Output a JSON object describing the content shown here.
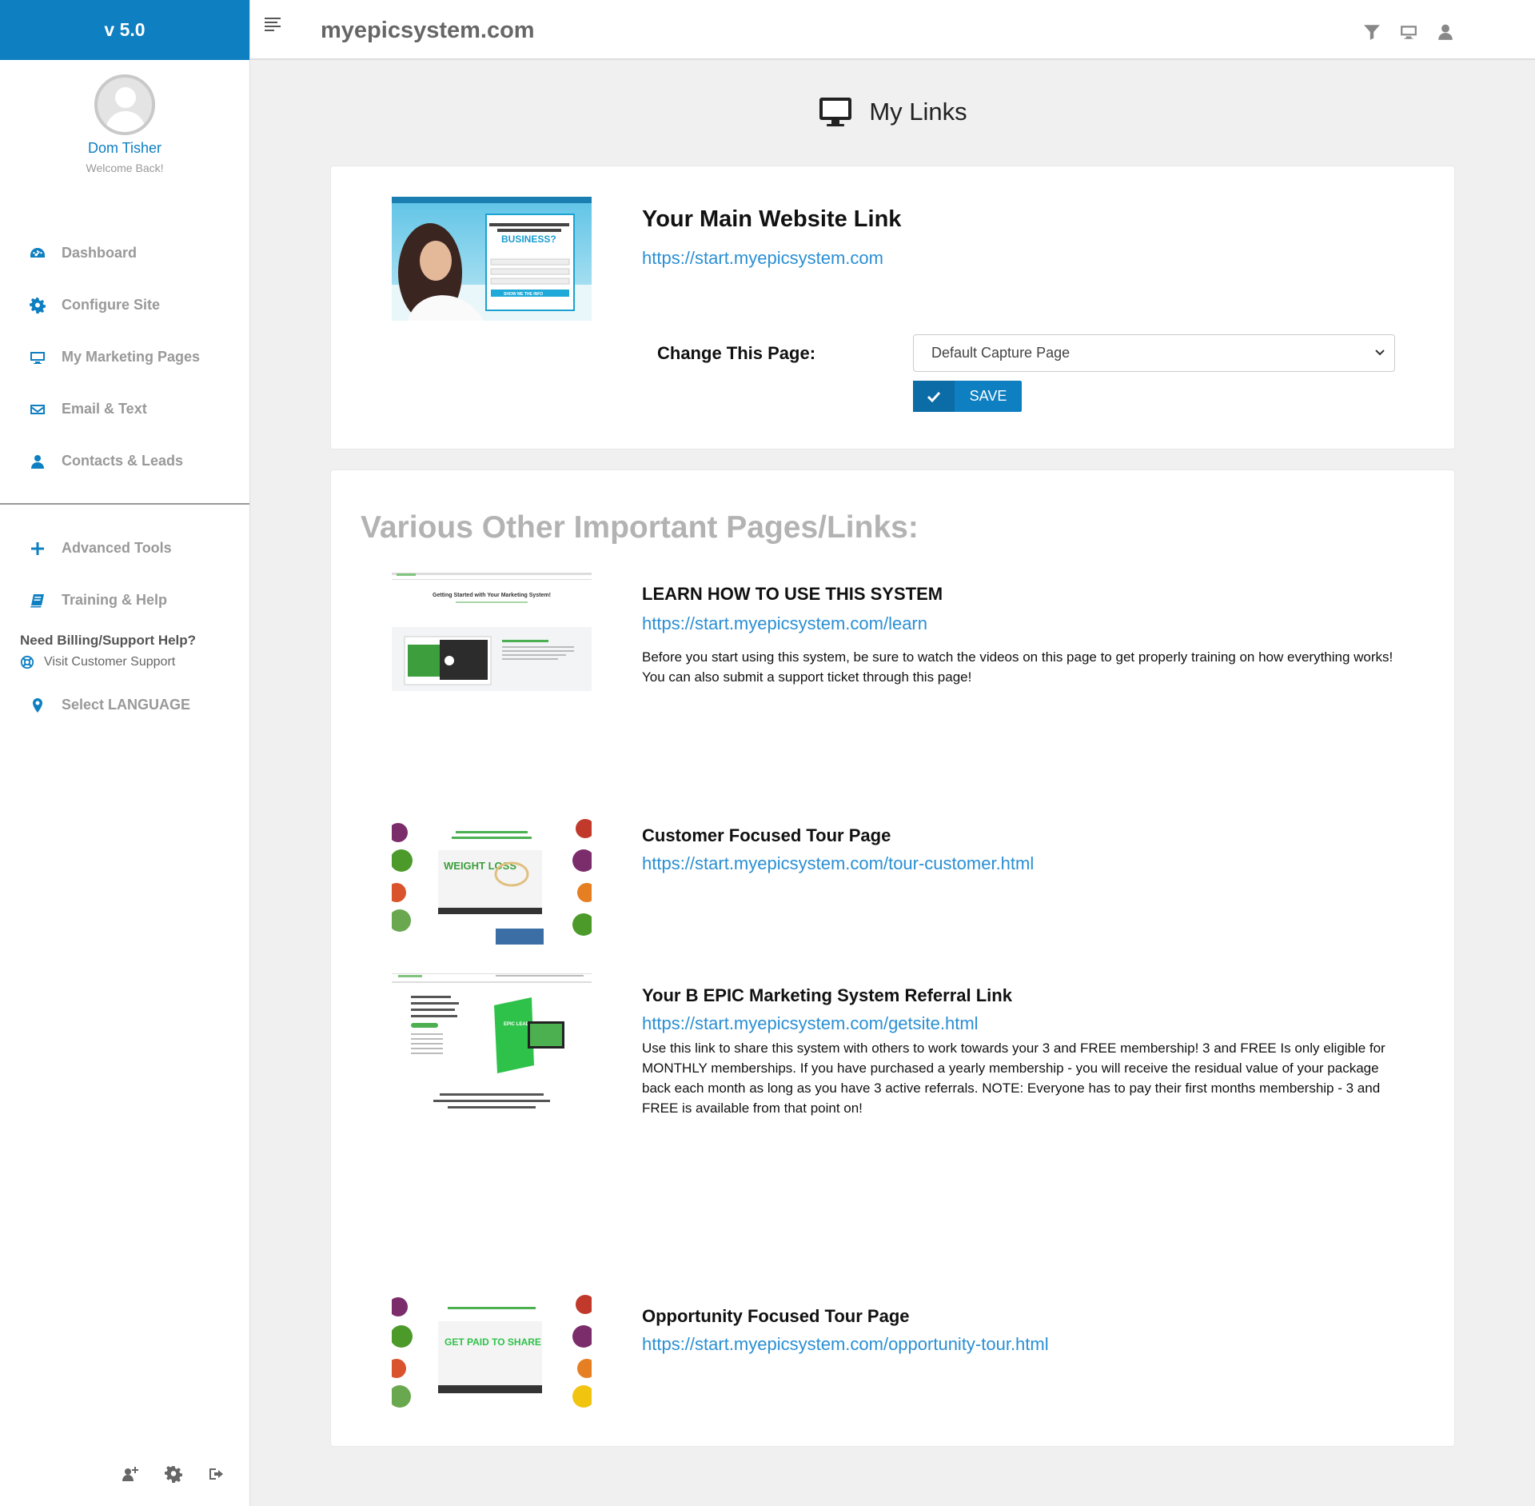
{
  "app": {
    "version": "v 5.0",
    "site_title": "myepicsystem.com"
  },
  "profile": {
    "name": "Dom Tisher",
    "subtitle": "Welcome Back!"
  },
  "sidebar": {
    "items": [
      {
        "label": "Dashboard",
        "icon": "dashboard-icon"
      },
      {
        "label": "Configure Site",
        "icon": "gear-icon"
      },
      {
        "label": "My Marketing Pages",
        "icon": "desktop-icon"
      },
      {
        "label": "Email & Text",
        "icon": "envelope-icon"
      },
      {
        "label": "Contacts & Leads",
        "icon": "user-icon"
      },
      {
        "label": "Advanced Tools",
        "icon": "plus-icon"
      },
      {
        "label": "Training & Help",
        "icon": "book-icon"
      }
    ],
    "support_title": "Need Billing/Support Help?",
    "support_link": "Visit Customer Support",
    "language": "Select LANGUAGE"
  },
  "page": {
    "heading": "My Links"
  },
  "main_link": {
    "title": "Your Main Website Link",
    "url": "https://start.myepicsystem.com",
    "change_label": "Change This Page:",
    "select_value": "Default Capture Page",
    "save_label": "SAVE",
    "thumb": {
      "headline": "BUSINESS?",
      "button": "SHOW ME THE INFO"
    }
  },
  "other_section": {
    "title": "Various Other Important Pages/Links:",
    "links": [
      {
        "title": "LEARN HOW TO USE THIS SYSTEM",
        "url": "https://start.myepicsystem.com/learn",
        "description": "Before you start using this system, be sure to watch the videos on this page to get properly training on how everything works! You can also submit a support ticket through this page!",
        "thumb_text": "Getting Started with Your Marketing System!"
      },
      {
        "title": "Customer Focused Tour Page",
        "url": "https://start.myepicsystem.com/tour-customer.html",
        "description": "",
        "thumb_text": "WEIGHT LOSS"
      },
      {
        "title": "Your B EPIC Marketing System Referral Link",
        "url": "https://start.myepicsystem.com/getsite.html",
        "description": "Use this link to share this system with others to work towards your 3 and FREE membership! 3 and FREE Is only eligible for MONTHLY memberships. If you have purchased a yearly membership - you will receive the residual value of your package back each month as long as you have 3 active referrals. NOTE: Everyone has to pay their first months membership - 3 and FREE is available from that point on!",
        "thumb_text": "EPIC LEAD GEN"
      },
      {
        "title": "Opportunity Focused Tour Page",
        "url": "https://start.myepicsystem.com/opportunity-tour.html",
        "description": "",
        "thumb_text": "GET PAID TO SHARE"
      }
    ]
  },
  "colors": {
    "brand": "#0e7fc1",
    "link": "#2a8fd4",
    "muted": "#999999",
    "section_title": "#b3b3b3"
  }
}
